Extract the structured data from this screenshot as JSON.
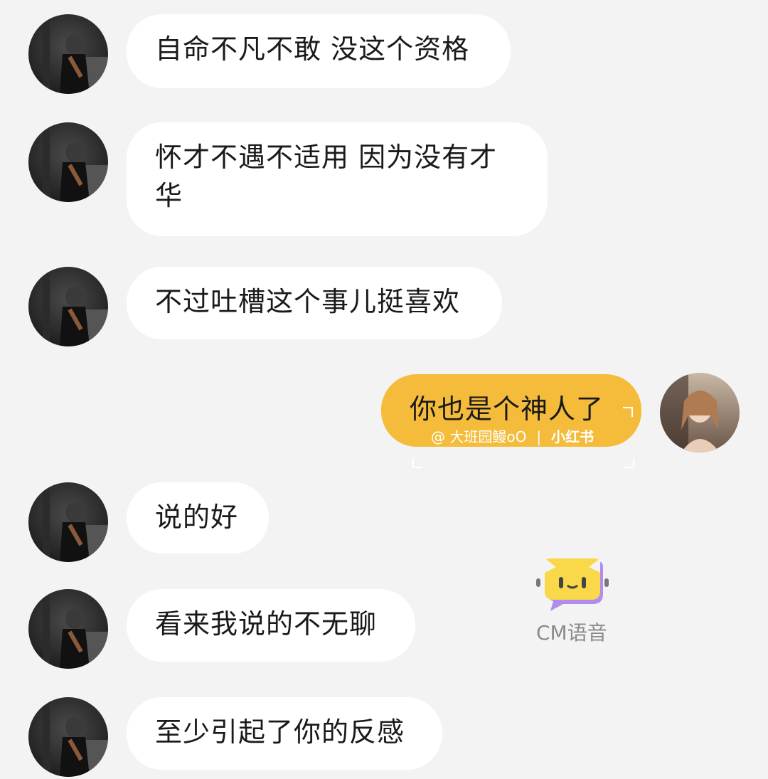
{
  "messages": [
    {
      "sender": "other",
      "text": "自命不凡不敢 没这个资格"
    },
    {
      "sender": "other",
      "text": "怀才不遇不适用  因为没有才华"
    },
    {
      "sender": "other",
      "text": "不过吐槽这个事儿挺喜欢"
    },
    {
      "sender": "self",
      "text": "你也是个神人了"
    },
    {
      "sender": "other",
      "text": "说的好"
    },
    {
      "sender": "other",
      "text": "看来我说的不无聊"
    },
    {
      "sender": "other",
      "text": "至少引起了你的反感"
    }
  ],
  "watermark": {
    "handle": "@ 大班园鳗oO",
    "separator": "|",
    "brand": "小红书"
  },
  "overlay_logo": {
    "text": "CM语音",
    "icon": "cm-voice-logo-icon"
  },
  "colors": {
    "background": "#f3f3f3",
    "other_bubble": "#ffffff",
    "self_bubble": "#f4bc3a",
    "text": "#1a1a1a",
    "logo_yellow": "#f9d84a",
    "logo_purple": "#b18cf0"
  }
}
